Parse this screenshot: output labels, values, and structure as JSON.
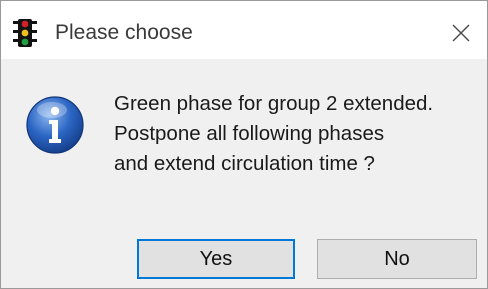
{
  "window": {
    "title": "Please choose",
    "app_icon": "traffic-light-icon",
    "close_icon": "close-icon"
  },
  "message": {
    "icon": "info-icon",
    "lines": [
      "Green phase for group 2 extended.",
      "Postpone all following phases",
      "and extend circulation time ?"
    ]
  },
  "buttons": {
    "yes_label": "Yes",
    "no_label": "No",
    "default": "Yes"
  },
  "colors": {
    "focus_border": "#0078d7",
    "info_blue": "#2b66c4",
    "traffic_red": "#d0202a",
    "traffic_yellow": "#f0c020",
    "traffic_green": "#1fa040"
  }
}
